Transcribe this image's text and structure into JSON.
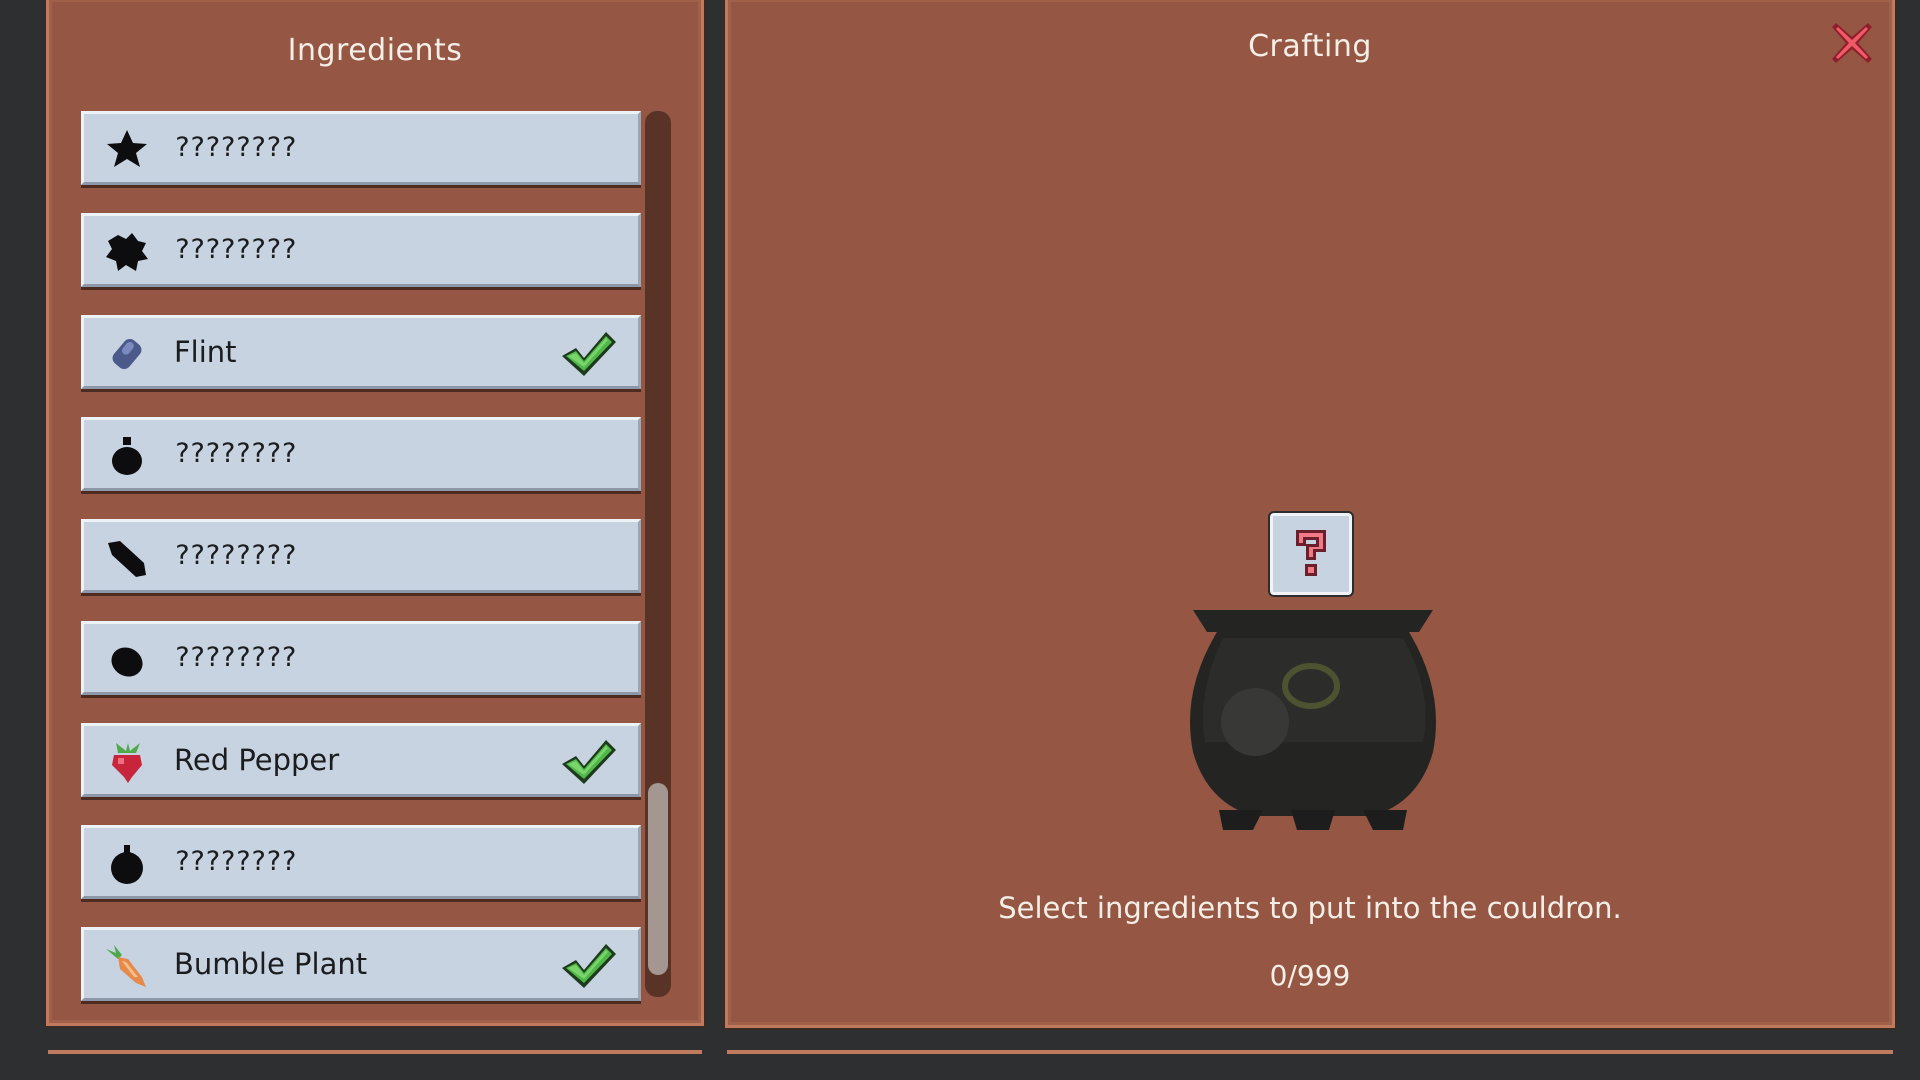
{
  "ingredients_panel": {
    "title": "Ingredients",
    "items": [
      {
        "label": "????????",
        "icon": "star-silhouette-icon",
        "discovered": false
      },
      {
        "label": "????????",
        "icon": "blob-silhouette-icon",
        "discovered": false
      },
      {
        "label": "Flint",
        "icon": "flint-stone-icon",
        "discovered": true
      },
      {
        "label": "????????",
        "icon": "pouch-silhouette-icon",
        "discovered": false
      },
      {
        "label": "????????",
        "icon": "leaf-silhouette-icon",
        "discovered": false
      },
      {
        "label": "????????",
        "icon": "seed-silhouette-icon",
        "discovered": false
      },
      {
        "label": "Red Pepper",
        "icon": "red-pepper-icon",
        "discovered": true
      },
      {
        "label": "????????",
        "icon": "round-silhouette-icon",
        "discovered": false
      },
      {
        "label": "Bumble Plant",
        "icon": "bumble-plant-icon",
        "discovered": true
      }
    ]
  },
  "crafting_panel": {
    "title": "Crafting",
    "instruction": "Select ingredients to put into the couldron.",
    "count": "0/999",
    "result_icon": "question-mark-icon",
    "close_icon": "close-icon"
  },
  "colors": {
    "panel": "#955644",
    "panel_border": "#c07a5e",
    "slot": "#c7d3e1",
    "check": "#3fa23a",
    "close": "#e8525e"
  }
}
